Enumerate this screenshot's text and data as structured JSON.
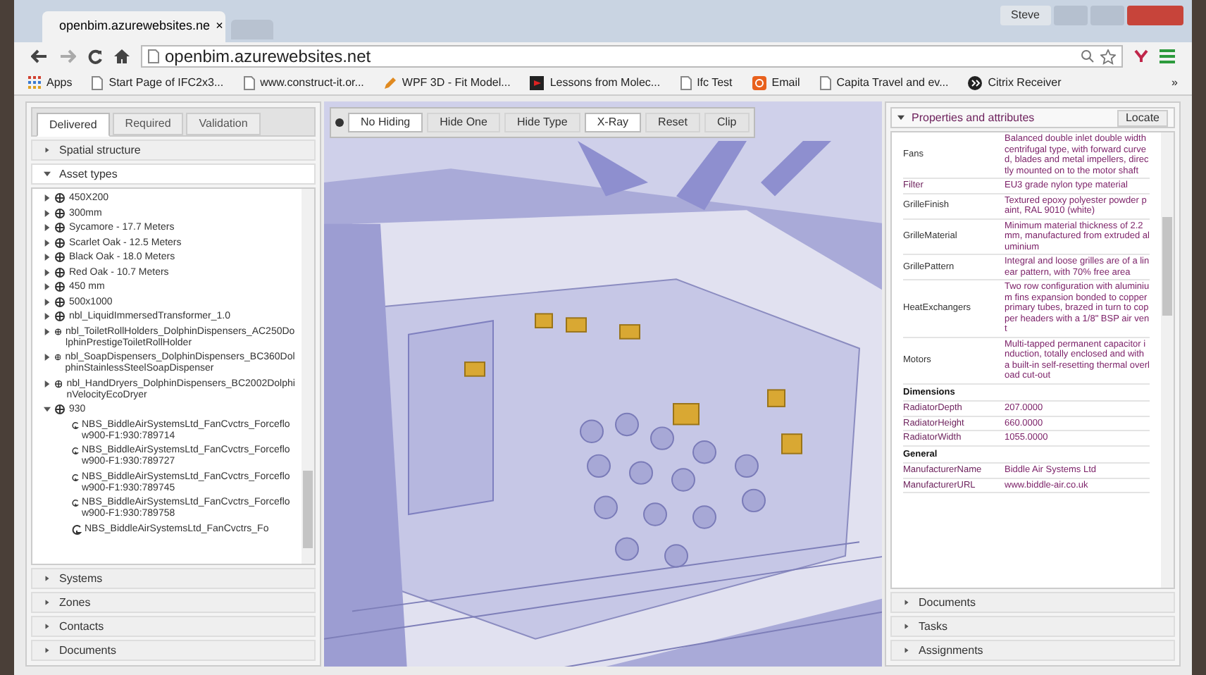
{
  "browser": {
    "tab_title": "openbim.azurewebsites.ne",
    "tab_close": "×",
    "user_badge": "Steve",
    "address": "openbim.azurewebsites.net",
    "bookmarks": [
      {
        "label": "Apps",
        "kind": "apps"
      },
      {
        "label": "Start Page of IFC2x3...",
        "kind": "page"
      },
      {
        "label": "www.construct-it.or...",
        "kind": "page"
      },
      {
        "label": "WPF 3D - Fit Model...",
        "kind": "tool"
      },
      {
        "label": "Lessons from Molec...",
        "kind": "video"
      },
      {
        "label": "Ifc Test",
        "kind": "page"
      },
      {
        "label": "Email",
        "kind": "mail"
      },
      {
        "label": "Capita Travel and ev...",
        "kind": "page"
      },
      {
        "label": "Citrix Receiver",
        "kind": "citrix"
      }
    ],
    "more": "»"
  },
  "left_panel": {
    "tabs": [
      {
        "label": "Delivered",
        "selected": true
      },
      {
        "label": "Required",
        "selected": false
      },
      {
        "label": "Validation",
        "selected": false
      }
    ],
    "sections_top": [
      {
        "label": "Spatial structure",
        "expanded": false
      },
      {
        "label": "Asset types",
        "expanded": true
      }
    ],
    "tree": [
      {
        "label": "450X200",
        "expanded": false
      },
      {
        "label": "300mm",
        "expanded": false
      },
      {
        "label": "Sycamore - 17.7 Meters",
        "expanded": false
      },
      {
        "label": "Scarlet Oak - 12.5 Meters",
        "expanded": false
      },
      {
        "label": "Black Oak - 18.0 Meters",
        "expanded": false
      },
      {
        "label": "Red Oak - 10.7 Meters",
        "expanded": false
      },
      {
        "label": "450 mm",
        "expanded": false
      },
      {
        "label": "500x1000",
        "expanded": false
      },
      {
        "label": "nbl_LiquidImmersedTransformer_1.0",
        "expanded": false
      },
      {
        "label": "nbl_ToiletRollHolders_DolphinDispensers_AC250DolphinPrestigeToiletRollHolder",
        "expanded": false
      },
      {
        "label": "nbl_SoapDispensers_DolphinDispensers_BC360DolphinStainlessSteelSoapDispenser",
        "expanded": false
      },
      {
        "label": "nbl_HandDryers_DolphinDispensers_BC2002DolphinVelocityEcoDryer",
        "expanded": false
      },
      {
        "label": "930",
        "expanded": true,
        "children": [
          {
            "label": "NBS_BiddleAirSystemsLtd_FanCvctrs_Forceflow900-F1:930:789714"
          },
          {
            "label": "NBS_BiddleAirSystemsLtd_FanCvctrs_Forceflow900-F1:930:789727"
          },
          {
            "label": "NBS_BiddleAirSystemsLtd_FanCvctrs_Forceflow900-F1:930:789745"
          },
          {
            "label": "NBS_BiddleAirSystemsLtd_FanCvctrs_Forceflow900-F1:930:789758"
          },
          {
            "label": "NBS_BiddleAirSystemsLtd_FanCvctrs_Fo"
          }
        ]
      }
    ],
    "sections_bottom": [
      {
        "label": "Systems",
        "expanded": false
      },
      {
        "label": "Zones",
        "expanded": false
      },
      {
        "label": "Contacts",
        "expanded": false
      },
      {
        "label": "Documents",
        "expanded": false
      }
    ]
  },
  "toolbar": {
    "buttons": [
      {
        "label": "No Hiding",
        "selected": true
      },
      {
        "label": "Hide One",
        "selected": false
      },
      {
        "label": "Hide Type",
        "selected": false
      },
      {
        "label": "X-Ray",
        "selected": true
      },
      {
        "label": "Reset",
        "selected": false
      },
      {
        "label": "Clip",
        "selected": false
      }
    ]
  },
  "right_panel": {
    "header": {
      "label": "Properties and attributes",
      "expanded": true
    },
    "locate": "Locate",
    "rows": [
      {
        "kind": "property",
        "name": "Fans",
        "value": "Balanced double inlet double width centrifugal type, with forward curved, blades and metal impellers, directly mounted on to the motor shaft"
      },
      {
        "kind": "property",
        "name": "Filter",
        "value": "EU3 grade nylon type material"
      },
      {
        "kind": "property",
        "name": "GrilleFinish",
        "value": "Textured epoxy polyester powder paint, RAL 9010 (white)"
      },
      {
        "kind": "property",
        "name": "GrilleMaterial",
        "value": "Minimum material thickness of 2.2 mm, manufactured from extruded aluminium"
      },
      {
        "kind": "property",
        "name": "GrillePattern",
        "value": "Integral and loose grilles are of a linear pattern, with 70% free area"
      },
      {
        "kind": "property",
        "name": "HeatExchangers",
        "value": "Two row configuration with aluminium fins expansion bonded to copper primary tubes, brazed in turn to copper headers with a 1/8\" BSP air vent"
      },
      {
        "kind": "property",
        "name": "Motors",
        "value": "Multi-tapped permanent capacitor induction, totally enclosed and with a built-in self-resetting thermal overload cut-out"
      },
      {
        "kind": "group",
        "name": "Dimensions"
      },
      {
        "kind": "property",
        "name": "RadiatorDepth",
        "value": "207.0000"
      },
      {
        "kind": "property",
        "name": "RadiatorHeight",
        "value": "660.0000"
      },
      {
        "kind": "property",
        "name": "RadiatorWidth",
        "value": "1055.0000"
      },
      {
        "kind": "group",
        "name": "General"
      },
      {
        "kind": "property",
        "name": "ManufacturerName",
        "value": "Biddle Air Systems Ltd"
      },
      {
        "kind": "property",
        "name": "ManufacturerURL",
        "value": "www.biddle-air.co.uk"
      }
    ],
    "sections_bottom": [
      {
        "label": "Documents",
        "expanded": false
      },
      {
        "label": "Tasks",
        "expanded": false
      },
      {
        "label": "Assignments",
        "expanded": false
      }
    ]
  }
}
